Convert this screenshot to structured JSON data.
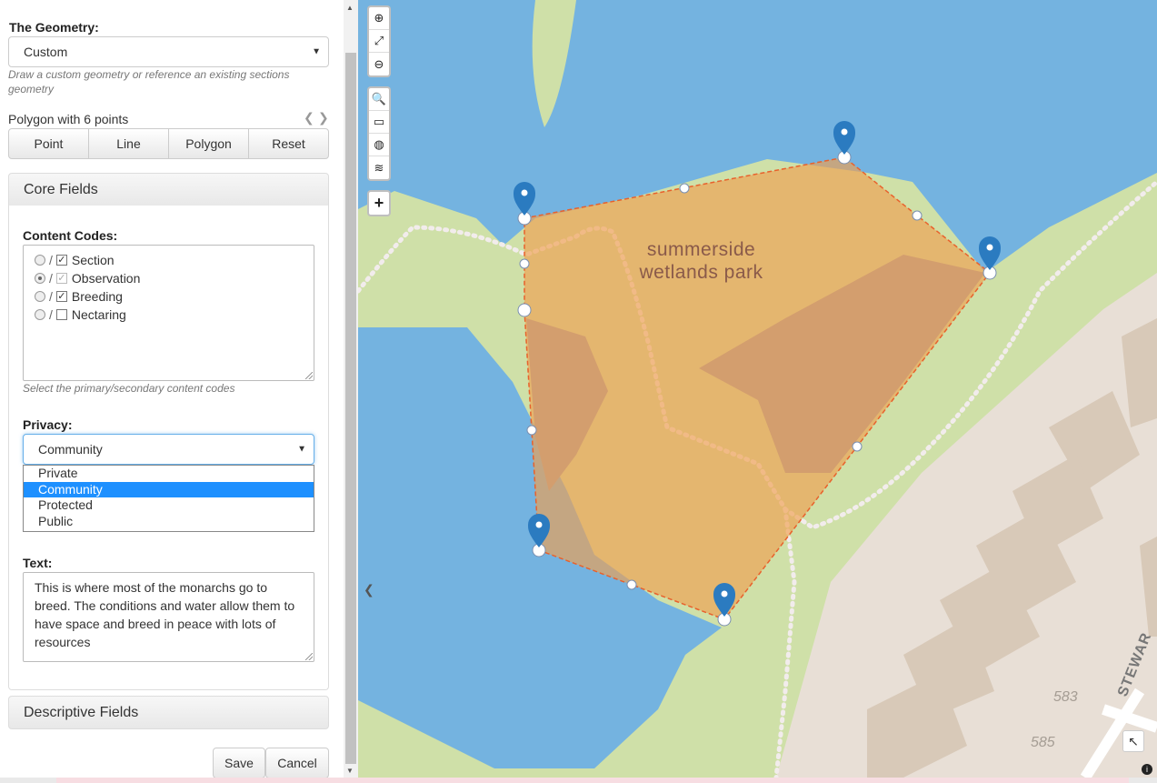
{
  "geometry": {
    "label": "The Geometry:",
    "selected": "Custom",
    "help": "Draw a custom geometry or reference an existing sections geometry",
    "status": "Polygon with 6 points",
    "buttons": [
      "Point",
      "Line",
      "Polygon",
      "Reset"
    ]
  },
  "core_fields": {
    "title": "Core Fields",
    "content_codes_label": "Content Codes:",
    "codes": [
      {
        "label": "Section",
        "primary": false,
        "secondary": true
      },
      {
        "label": "Observation",
        "primary": true,
        "secondary": true
      },
      {
        "label": "Breeding",
        "primary": false,
        "secondary": true
      },
      {
        "label": "Nectaring",
        "primary": false,
        "secondary": false
      }
    ],
    "codes_help": "Select the primary/secondary content codes",
    "privacy_label": "Privacy:",
    "privacy_selected": "Community",
    "privacy_options": [
      "Private",
      "Community",
      "Protected",
      "Public"
    ],
    "text_label": "Text:",
    "text_value": "This is where most of the monarchs go to breed. The conditions and water allow them to have space and breed in peace with lots of resources"
  },
  "descriptive_fields": {
    "title": "Descriptive Fields"
  },
  "footer": {
    "save": "Save",
    "cancel": "Cancel"
  },
  "map": {
    "park_label_line1": "summerside",
    "park_label_line2": "wetlands park",
    "house_numbers": [
      "583",
      "585"
    ],
    "street": "STEWAR",
    "colors": {
      "water": "#74b3e0",
      "park": "#cfe0a8",
      "polygon": "#f0a050",
      "edge": "#e8612c",
      "marker": "#2b7bc0",
      "buildings": "#d8c9b8"
    },
    "toolbar_icons": [
      "zoom-in-icon",
      "fullscreen-icon",
      "zoom-out-icon",
      "search-icon",
      "select-area-icon",
      "globe-icon",
      "layers-icon",
      "add-icon"
    ],
    "toolbar_glyphs": [
      "⊕",
      "⤢",
      "⊖",
      "🔍",
      "▭",
      "◍",
      "≋",
      "+"
    ]
  }
}
